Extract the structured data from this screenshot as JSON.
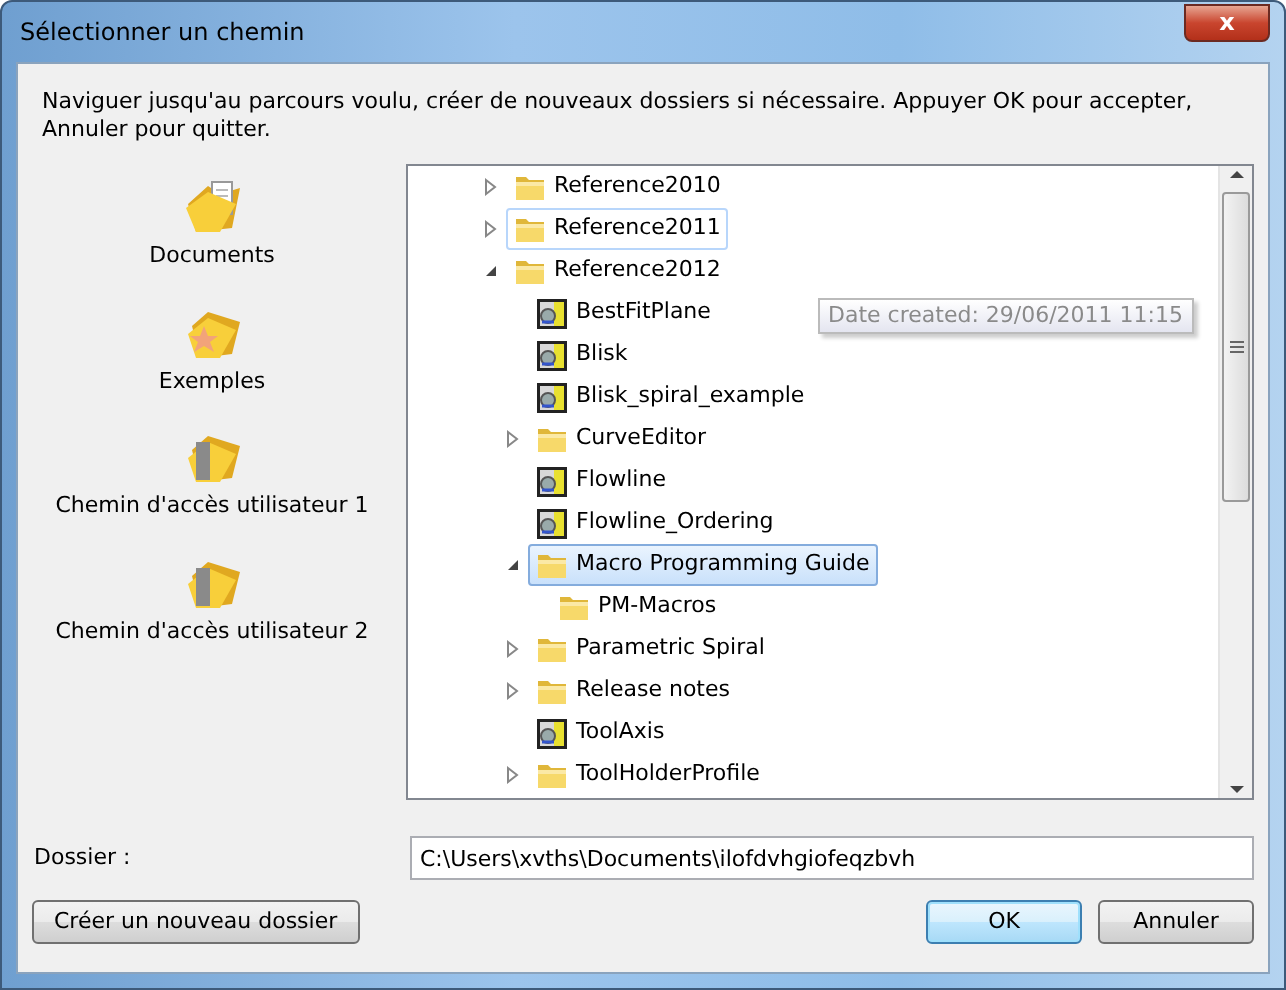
{
  "window": {
    "title": "Sélectionner un chemin",
    "close_label": "x"
  },
  "instructions": "Naviguer jusqu'au parcours voulu, créer de nouveaux dossiers si nécessaire. Appuyer OK pour accepter, Annuler pour quitter.",
  "places": [
    {
      "label": "Documents",
      "kind": "documents"
    },
    {
      "label": "Exemples",
      "kind": "examples"
    },
    {
      "label": "Chemin d'accès utilisateur 1",
      "kind": "user-path"
    },
    {
      "label": "Chemin d'accès utilisateur 2",
      "kind": "user-path"
    }
  ],
  "tree": [
    {
      "label": "Reference2010",
      "kind": "folder",
      "expanded": false,
      "selected": false,
      "hovered": false
    },
    {
      "label": "Reference2011",
      "kind": "folder",
      "expanded": false,
      "selected": false,
      "hovered": true
    },
    {
      "label": "Reference2012",
      "kind": "folder",
      "expanded": true,
      "selected": false,
      "hovered": false,
      "children": [
        {
          "label": "BestFitPlane",
          "kind": "macro",
          "selected": false,
          "hovered": false,
          "tooltip": "Date created: 29/06/2011 11:15"
        },
        {
          "label": "Blisk",
          "kind": "macro",
          "selected": false,
          "hovered": false
        },
        {
          "label": "Blisk_spiral_example",
          "kind": "macro",
          "selected": false,
          "hovered": false
        },
        {
          "label": "CurveEditor",
          "kind": "folder",
          "expanded": false,
          "selected": false,
          "hovered": false
        },
        {
          "label": "Flowline",
          "kind": "macro",
          "selected": false,
          "hovered": false
        },
        {
          "label": "Flowline_Ordering",
          "kind": "macro",
          "selected": false,
          "hovered": false
        },
        {
          "label": "Macro Programming Guide",
          "kind": "folder",
          "expanded": true,
          "selected": true,
          "hovered": false,
          "children": [
            {
              "label": "PM-Macros",
              "kind": "folder",
              "selected": false,
              "hovered": false
            }
          ]
        },
        {
          "label": "Parametric Spiral",
          "kind": "folder",
          "expanded": false,
          "selected": false,
          "hovered": false
        },
        {
          "label": "Release notes",
          "kind": "folder",
          "expanded": false,
          "selected": false,
          "hovered": false
        },
        {
          "label": "ToolAxis",
          "kind": "macro",
          "selected": false,
          "hovered": false
        },
        {
          "label": "ToolHolderProfile",
          "kind": "folder",
          "expanded": false,
          "selected": false,
          "hovered": false
        }
      ]
    }
  ],
  "folder_field": {
    "label": "Dossier :",
    "value": "C:\\Users\\xvths\\Documents\\ilofdvhgiofeqzbvh"
  },
  "buttons": [
    {
      "label": "Créer un nouveau dossier",
      "kind": "secondary",
      "default": false
    },
    {
      "label": "OK",
      "kind": "primary",
      "default": true
    },
    {
      "label": "Annuler",
      "kind": "primary",
      "default": false
    }
  ]
}
